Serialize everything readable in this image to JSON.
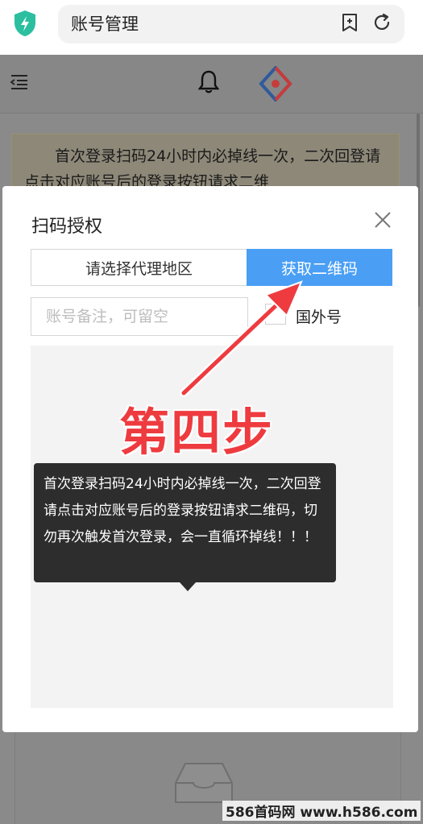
{
  "browser": {
    "title": "账号管理"
  },
  "notice": {
    "text": "首次登录扫码24小时内必掉线一次，二次回登请点击对应账号后的登录按钮请求二维"
  },
  "modal": {
    "title": "扫码授权",
    "region_button": "请选择代理地区",
    "qr_button": "获取二维码",
    "remark_placeholder": "账号备注，可留空",
    "foreign_label": "国外号"
  },
  "tooltip": {
    "text": "首次登录扫码24小时内必掉线一次，二次回登请点击对应账号后的登录按钮请求二维码，切勿再次触发首次登录，会一直循环掉线！！！"
  },
  "annotation": {
    "step_label": "第四步"
  },
  "watermark": {
    "text": "586首码网 www.h586.com"
  },
  "colors": {
    "accent_blue": "#4a9ff5",
    "annotation_red": "#ee3b3f",
    "shield_green": "#2bbfa0"
  }
}
